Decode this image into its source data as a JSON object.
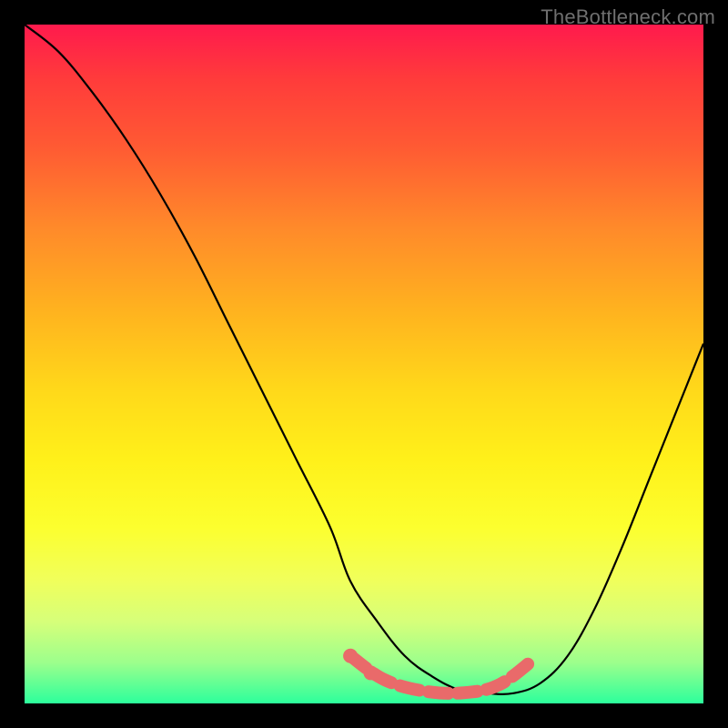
{
  "watermark": "TheBottleneck.com",
  "chart_data": {
    "type": "line",
    "title": "",
    "xlabel": "",
    "ylabel": "",
    "xlim": [
      0,
      100
    ],
    "ylim": [
      0,
      100
    ],
    "series": [
      {
        "name": "bottleneck-curve",
        "color": "#000000",
        "x": [
          0,
          5,
          10,
          15,
          20,
          25,
          30,
          35,
          40,
          45,
          48,
          52,
          56,
          60,
          64,
          68,
          72,
          76,
          80,
          84,
          88,
          92,
          96,
          100
        ],
        "y": [
          100,
          96,
          90,
          83,
          75,
          66,
          56,
          46,
          36,
          26,
          18,
          12,
          7,
          4,
          2,
          1.5,
          1.5,
          3,
          7,
          14,
          23,
          33,
          43,
          53
        ]
      },
      {
        "name": "optimal-range",
        "color": "#e96a6a",
        "x": [
          48,
          53,
          59,
          65,
          70,
          75
        ],
        "y": [
          7,
          3.5,
          1.8,
          1.6,
          2.8,
          6.5
        ]
      }
    ],
    "markers": [
      {
        "name": "optimal-dot-1",
        "x": 48,
        "y": 7,
        "color": "#e96a6a"
      },
      {
        "name": "optimal-dot-2",
        "x": 51,
        "y": 4.5,
        "color": "#e96a6a"
      }
    ]
  }
}
